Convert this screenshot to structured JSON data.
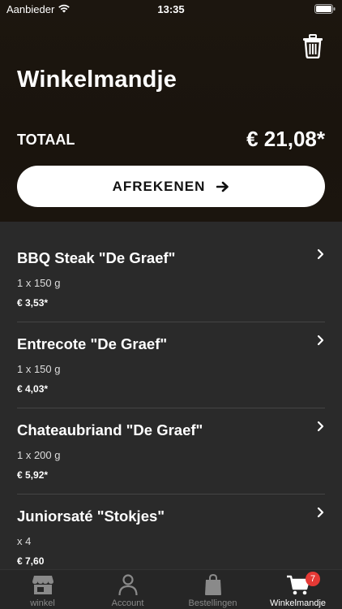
{
  "status_bar": {
    "carrier": "Aanbieder",
    "time": "13:35"
  },
  "header": {
    "title": "Winkelmandje",
    "total_label": "TOTAAL",
    "total_value": "€ 21,08*",
    "checkout_label": "AFREKENEN"
  },
  "items": [
    {
      "name": "BBQ Steak \"De Graef\"",
      "qty": "1 x 150 g",
      "price": "€ 3,53*"
    },
    {
      "name": "Entrecote \"De Graef\"",
      "qty": "1 x 150 g",
      "price": "€ 4,03*"
    },
    {
      "name": "Chateaubriand \"De Graef\"",
      "qty": "1 x 200 g",
      "price": "€ 5,92*"
    },
    {
      "name": "Juniorsaté \"Stokjes\"",
      "qty": "x 4",
      "price": "€ 7,60"
    }
  ],
  "tabs": [
    {
      "label": "winkel",
      "icon": "shop-icon"
    },
    {
      "label": "Account",
      "icon": "person-icon"
    },
    {
      "label": "Bestellingen",
      "icon": "bag-icon"
    },
    {
      "label": "Winkelmandje",
      "icon": "cart-icon",
      "badge": "7"
    }
  ]
}
